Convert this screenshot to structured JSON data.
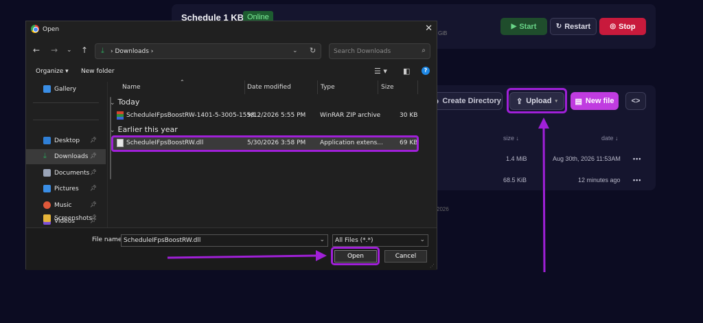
{
  "panel": {
    "server_name": "Schedule 1 KB 2",
    "status": "Online",
    "mem_text": "GiB",
    "start_label": "Start",
    "restart_label": "Restart",
    "stop_label": "Stop",
    "create_dir_label": "Create Directory",
    "upload_label": "Upload",
    "new_file_label": "New file",
    "code_label": "<>",
    "col_size": "size ↓",
    "col_date": "date ↓",
    "rows": [
      {
        "size": "1.4 MiB",
        "date": "Aug 30th, 2026 11:53AM",
        "menu": "•••"
      },
      {
        "size": "68.5 KiB",
        "date": "12 minutes ago",
        "menu": "•••"
      }
    ],
    "footer_text": "2026"
  },
  "dialog": {
    "title": "Open",
    "address_path": "› Downloads ›",
    "search_placeholder": "Search Downloads",
    "organize_label": "Organize ▾",
    "new_folder_label": "New folder",
    "nav_items": [
      {
        "label": "Gallery",
        "color": "#3a8ee6"
      },
      {
        "label": "Desktop",
        "color": "#2f7fd6"
      },
      {
        "label": "Downloads",
        "color": "#2e9e5a"
      },
      {
        "label": "Documents",
        "color": "#9aa4b8"
      },
      {
        "label": "Pictures",
        "color": "#3a8ee6"
      },
      {
        "label": "Music",
        "color": "#e0583a"
      },
      {
        "label": "Videos",
        "color": "#7b4fd6"
      },
      {
        "label": "Screenshots",
        "color": "#e6b53a"
      }
    ],
    "columns": {
      "name": "Name",
      "date": "Date modified",
      "type": "Type",
      "size": "Size"
    },
    "groups": [
      {
        "label": "Today",
        "files": [
          {
            "name": "ScheduleIFpsBoostRW-1401-5-3005-1558...",
            "date": "9/12/2026 5:55 PM",
            "type": "WinRAR ZIP archive",
            "size": "30 KB"
          }
        ]
      },
      {
        "label": "Earlier this year",
        "files": [
          {
            "name": "ScheduleIFpsBoostRW.dll",
            "date": "5/30/2026 3:58 PM",
            "type": "Application extens...",
            "size": "69 KB"
          }
        ]
      }
    ],
    "file_name_label": "File name:",
    "file_name_value": "ScheduleIFpsBoostRW.dll",
    "file_type": "All Files (*.*)",
    "open_label": "Open",
    "cancel_label": "Cancel"
  },
  "colors": {
    "highlight": "#a020d8",
    "accent": "#c03ce0",
    "stop": "#c81a3c",
    "start": "#69d588"
  }
}
